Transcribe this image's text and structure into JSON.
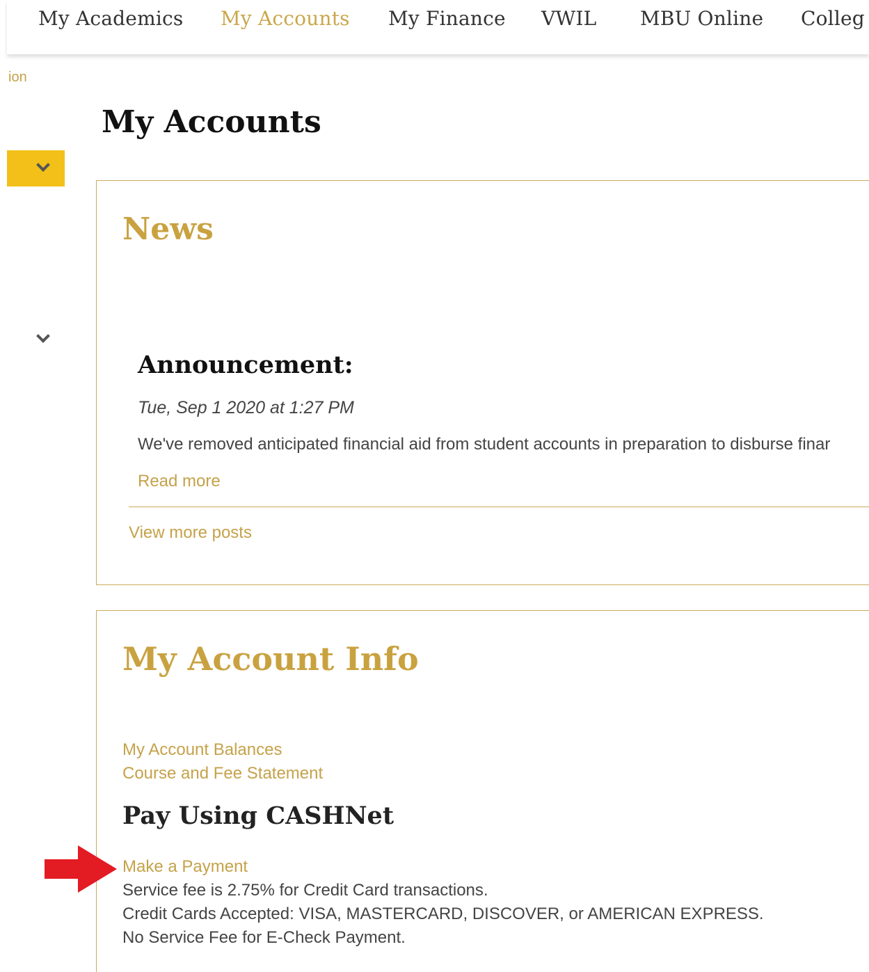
{
  "topnav": {
    "items": [
      {
        "label": "My Academics",
        "active": false
      },
      {
        "label": "My Accounts",
        "active": true
      },
      {
        "label": "My Finance",
        "active": false
      },
      {
        "label": "VWIL",
        "active": false
      },
      {
        "label": "MBU Online",
        "active": false
      },
      {
        "label": "Colleg",
        "active": false
      }
    ]
  },
  "breadcrumb": "ion",
  "page_title": "My Accounts",
  "sidebar": {
    "toggle_icon": "chevron-down-icon",
    "section_icon": "chevron-down-icon"
  },
  "news": {
    "heading": "News",
    "announcement": {
      "title": "Announcement:",
      "date": "Tue, Sep 1 2020 at 1:27 PM",
      "body": "We've removed anticipated financial aid from student accounts in preparation to disburse finar",
      "read_more": "Read more"
    },
    "view_more": "View more posts"
  },
  "account_info": {
    "heading": "My Account Info",
    "links": [
      "My Account Balances",
      "Course and Fee Statement"
    ],
    "cashnet": {
      "heading": "Pay Using CASHNet",
      "payment_link": "Make a Payment",
      "fee_note": "Service fee is 2.75% for Credit Card transactions.",
      "cards_note": "Credit Cards Accepted: VISA, MASTERCARD, DISCOVER, or AMERICAN EXPRESS.",
      "echeck_note": "No Service Fee for E-Check Payment."
    }
  },
  "colors": {
    "gold": "#c9a240",
    "toggle_yellow": "#f2c019",
    "arrow_red": "#e31b23"
  },
  "annotation": {
    "icon": "arrow-right-icon"
  }
}
